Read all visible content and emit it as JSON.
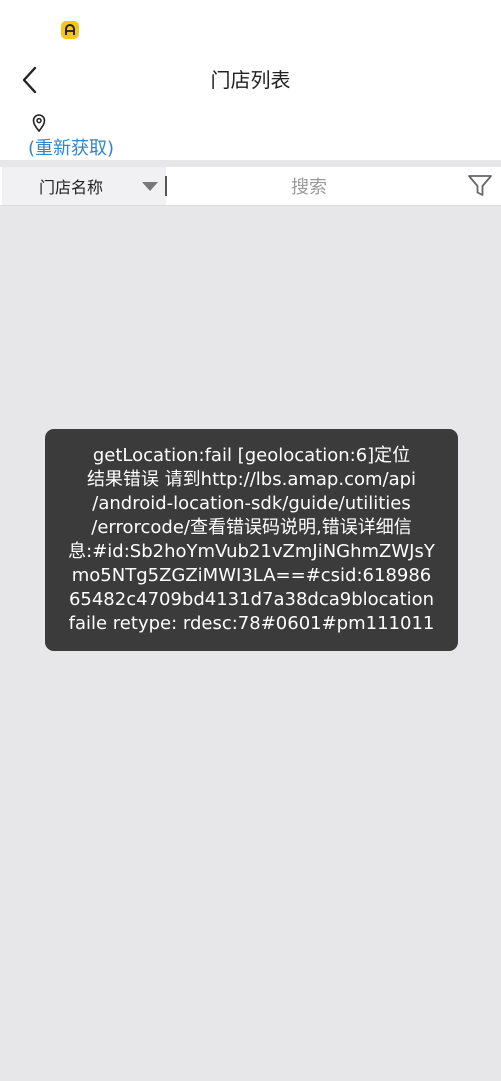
{
  "status": {
    "app_icon": "app-badge-icon",
    "badge_color": "#f5c518"
  },
  "header": {
    "back_icon": "chevron-left-icon",
    "title": "门店列表"
  },
  "location": {
    "pin_icon": "location-pin-icon",
    "refresh_label": "(重新获取)",
    "accent": "#2f86c8"
  },
  "filter_bar": {
    "store_select_label": "门店名称",
    "dropdown_icon": "caret-down-icon",
    "search_placeholder": "搜索",
    "filter_icon": "funnel-icon"
  },
  "toast": {
    "lines": [
      "getLocation:fail [geolocation:6]定位",
      "结果错误 请到http://lbs.amap.com/api",
      "/android-location-sdk/guide/utilities",
      "/errorcode/查看错误码说明,错误详细信",
      "息:#id:Sb2hoYmVub21vZmJiNGhmZWJsY",
      "mo5NTg5ZGZiMWI3LA==#csid:618986",
      "65482c4709bd4131d7a38dca9blocation",
      "faile retype: rdesc:78#0601#pm111011"
    ]
  }
}
